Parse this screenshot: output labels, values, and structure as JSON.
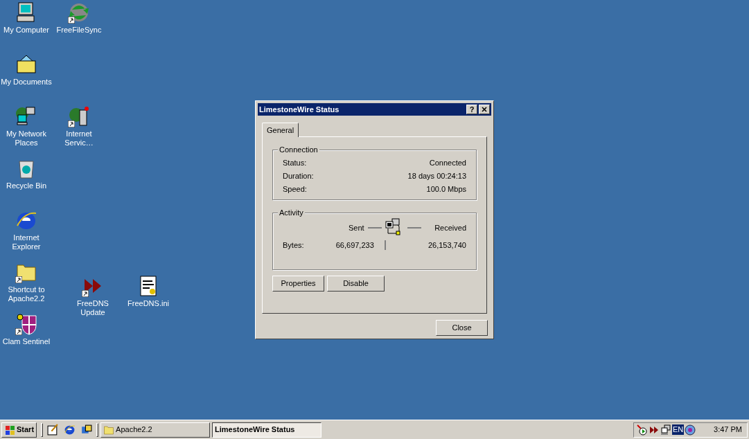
{
  "desktop": {
    "icons": [
      {
        "label": "My Computer",
        "kind": "computer",
        "shortcut": false
      },
      {
        "label": "FreeFileSync",
        "kind": "sync",
        "shortcut": true
      },
      {
        "label": "My Documents",
        "kind": "documents-folder",
        "shortcut": false
      },
      {
        "label": "My Network Places",
        "kind": "network",
        "shortcut": false
      },
      {
        "label": "Internet Servic…",
        "kind": "server",
        "shortcut": true
      },
      {
        "label": "Recycle Bin",
        "kind": "recycle",
        "shortcut": false
      },
      {
        "label": "Internet Explorer",
        "kind": "browser",
        "shortcut": false
      },
      {
        "label": "Shortcut to Apache2.2",
        "kind": "folder",
        "shortcut": true
      },
      {
        "label": "FreeDNS Update",
        "kind": "arrows",
        "shortcut": true
      },
      {
        "label": "FreeDNS.ini",
        "kind": "document",
        "shortcut": false
      },
      {
        "label": "Clam Sentinel",
        "kind": "shield",
        "shortcut": true
      }
    ]
  },
  "dialog": {
    "title": "LimestoneWire Status",
    "help_glyph": "?",
    "tabs": [
      {
        "label": "General",
        "selected": true
      }
    ],
    "connection": {
      "title": "Connection",
      "rows": [
        {
          "label": "Status:",
          "value": "Connected"
        },
        {
          "label": "Duration:",
          "value": "18 days 00:24:13"
        },
        {
          "label": "Speed:",
          "value": "100.0 Mbps"
        }
      ]
    },
    "activity": {
      "title": "Activity",
      "sent_label": "Sent",
      "received_label": "Received",
      "bytes_label": "Bytes:",
      "sent": "66,697,233",
      "received": "26,153,740"
    },
    "buttons": [
      "Properties",
      "Disable"
    ],
    "close_button": "Close"
  },
  "taskbar": {
    "start_label": "Start",
    "quick_launch": [
      {
        "kind": "desktop"
      },
      {
        "kind": "browser"
      },
      {
        "kind": "channels"
      }
    ],
    "tasks": [
      {
        "label": "Apache2.2",
        "kind": "folder",
        "selected": false
      },
      {
        "label": "LimestoneWire Status",
        "kind": "none",
        "selected": true
      }
    ],
    "tray": [
      {
        "kind": "player"
      },
      {
        "kind": "arrows"
      },
      {
        "kind": "network"
      },
      {
        "kind": "language",
        "label": "EN"
      },
      {
        "kind": "globe"
      }
    ],
    "clock": "3:47 PM"
  }
}
